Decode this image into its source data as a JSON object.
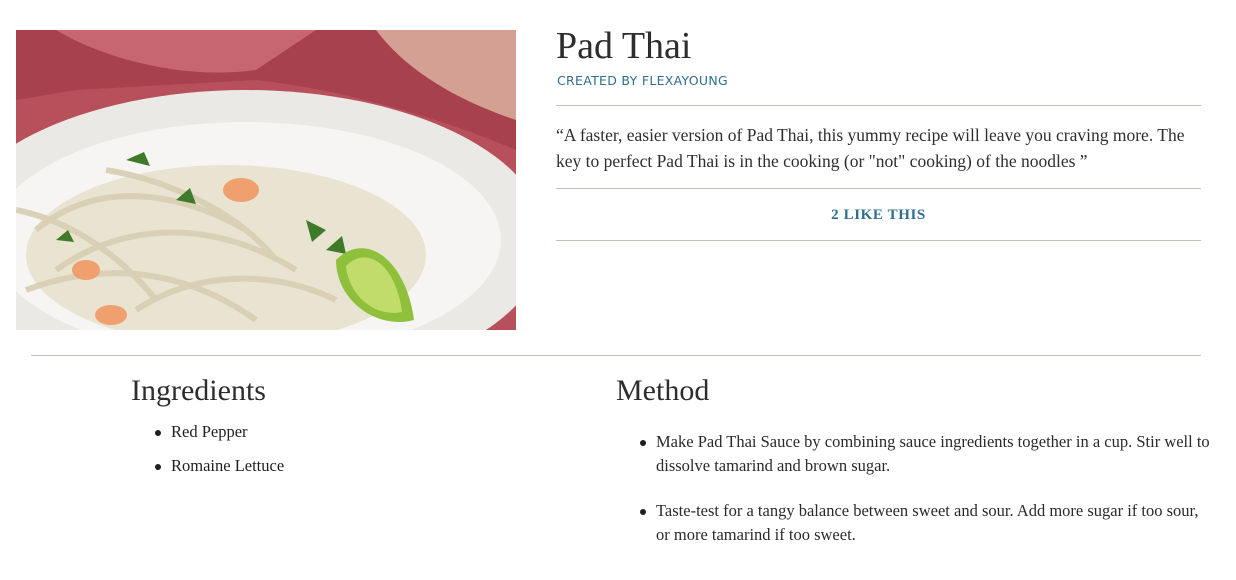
{
  "recipe": {
    "title": "Pad Thai",
    "author": "CREATED BY FLEXAYOUNG",
    "description": "“A faster, easier version of Pad Thai, this yummy recipe will leave you craving more. The key to perfect Pad Thai is in the cooking (or \"not\" cooking) of the noodles ”",
    "likes": "2 LIKE THIS"
  },
  "ingredients": {
    "heading": "Ingredients",
    "items": [
      "Red Pepper",
      "Romaine Lettuce"
    ]
  },
  "method": {
    "heading": "Method",
    "steps": [
      "Make Pad Thai Sauce by combining sauce ingredients together in a cup. Stir well to dissolve tamarind and brown sugar.",
      "Taste-test for a tangy balance between sweet and sour. Add more sugar if too sour, or more tamarind if too sweet."
    ]
  },
  "colors": {
    "accent": "#2f6e8f",
    "divider": "#c9c0b0",
    "text": "#2d2d2d"
  }
}
